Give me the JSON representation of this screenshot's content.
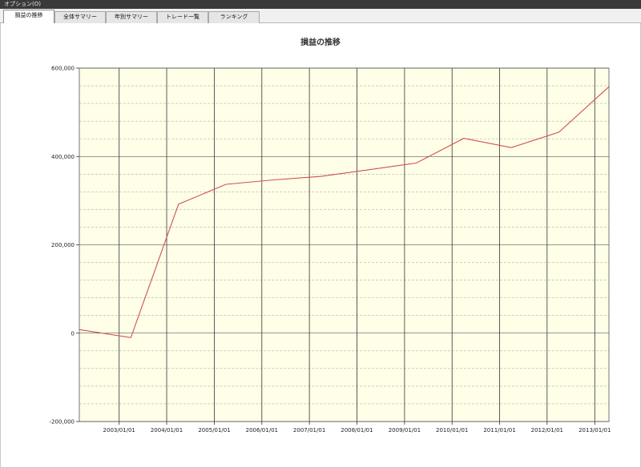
{
  "menubar": {
    "label": "オプション(O)"
  },
  "tabs": [
    {
      "label": "損益の推移"
    },
    {
      "label": "全体サマリー"
    },
    {
      "label": "年別サマリー"
    },
    {
      "label": "トレード一覧"
    },
    {
      "label": "ランキング"
    }
  ],
  "chart_data": {
    "type": "line",
    "title": "損益の推移",
    "xlabel": "",
    "ylabel": "",
    "ylim": [
      -200000,
      600000
    ],
    "xlim": [
      "2002/03/01",
      "2013/04/20"
    ],
    "y_ticks": [
      -200000,
      0,
      200000,
      400000,
      600000
    ],
    "y_tick_labels": [
      "-200,000",
      "0",
      "200,000",
      "400,000",
      "600,000"
    ],
    "x_ticks": [
      "2003/01/01",
      "2004/01/01",
      "2005/01/01",
      "2006/01/01",
      "2007/01/01",
      "2008/01/01",
      "2009/01/01",
      "2010/01/01",
      "2011/01/01",
      "2012/01/01",
      "2013/01/01"
    ],
    "x_tick_labels": [
      "2003/01/01",
      "2004/01/01",
      "2005/01/01",
      "2006/01/01",
      "2007/01/01",
      "2008/01/01",
      "2009/01/01",
      "2010/01/01",
      "2011/01/01",
      "2012/01/01",
      "2013/01/01"
    ],
    "grid": true,
    "minor_grid": true,
    "colors": {
      "background": "#ffffe8",
      "line": "#d05050",
      "grid_major": "#333333",
      "grid_minor": "#b0b0b0"
    },
    "series": [
      {
        "x": [
          "2002/03/01",
          "2003/04/01",
          "2004/04/01",
          "2005/04/01",
          "2006/04/01",
          "2007/04/01",
          "2008/04/01",
          "2009/04/01",
          "2010/04/01",
          "2011/04/01",
          "2012/04/01",
          "2013/04/20"
        ],
        "y": [
          8000,
          -10000,
          292000,
          337000,
          347000,
          355000,
          370000,
          385000,
          441000,
          420000,
          455000,
          558000
        ]
      }
    ]
  }
}
